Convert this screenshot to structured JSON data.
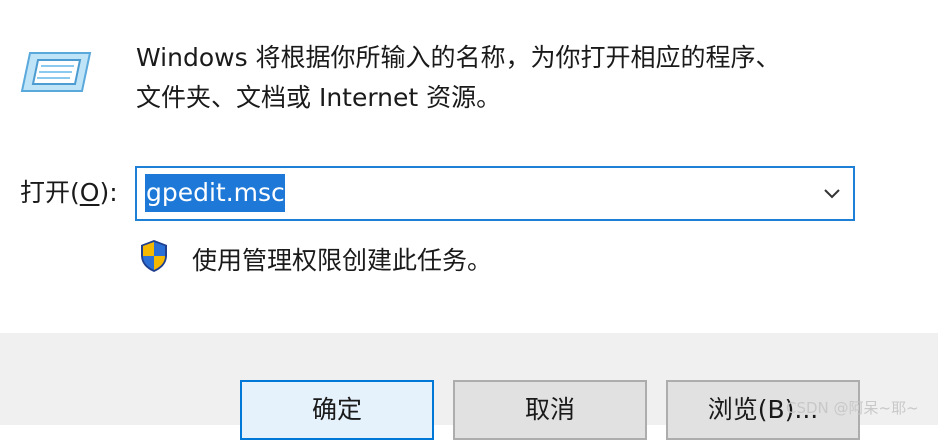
{
  "dialog": {
    "description_line1": "Windows 将根据你所输入的名称，为你打开相应的程序、",
    "description_line2": "文件夹、文档或 Internet 资源。",
    "open_label_prefix": "打开(",
    "open_label_key": "O",
    "open_label_suffix": "):",
    "open_value": "gpedit.msc",
    "admin_note": "使用管理权限创建此任务。"
  },
  "buttons": {
    "ok": "确定",
    "cancel": "取消",
    "browse": "浏览(B)..."
  },
  "watermark": "CSDN @阿呆~耶~",
  "icons": {
    "run": "run-dialog-icon",
    "shield": "uac-shield-icon",
    "dropdown": "chevron-down-icon"
  },
  "colors": {
    "selection": "#1e78d7",
    "focus_border": "#1e7fd6",
    "footer_bg": "#f0f0f0"
  }
}
